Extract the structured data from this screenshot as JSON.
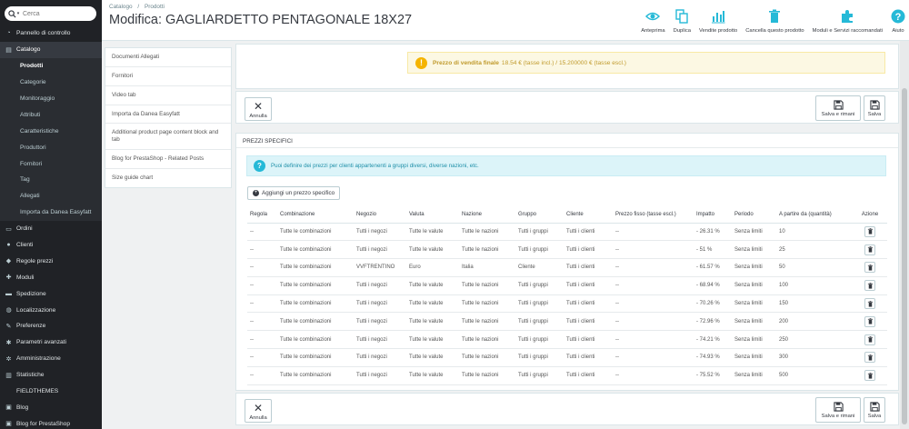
{
  "search": {
    "placeholder": "Cerca"
  },
  "sidebar": {
    "items": [
      {
        "label": "Pannello di controllo",
        "icon": "dashboard-icon"
      },
      {
        "label": "Catalogo",
        "icon": "store-icon",
        "active": true
      },
      {
        "label": "Prodotti",
        "sub": true,
        "current": true
      },
      {
        "label": "Categorie",
        "sub": true
      },
      {
        "label": "Monitoraggio",
        "sub": true
      },
      {
        "label": "Attributi",
        "sub": true
      },
      {
        "label": "Caratteristiche",
        "sub": true
      },
      {
        "label": "Produttori",
        "sub": true
      },
      {
        "label": "Fornitori",
        "sub": true
      },
      {
        "label": "Tag",
        "sub": true
      },
      {
        "label": "Allegati",
        "sub": true
      },
      {
        "label": "Importa da Danea Easyfatt",
        "sub": true
      },
      {
        "label": "Ordini",
        "icon": "credit-card-icon"
      },
      {
        "label": "Clienti",
        "icon": "user-icon"
      },
      {
        "label": "Regole prezzi",
        "icon": "tag-icon"
      },
      {
        "label": "Moduli",
        "icon": "puzzle-icon"
      },
      {
        "label": "Spedizione",
        "icon": "truck-icon"
      },
      {
        "label": "Localizzazione",
        "icon": "globe-icon"
      },
      {
        "label": "Preferenze",
        "icon": "wrench-icon"
      },
      {
        "label": "Parametri avanzati",
        "icon": "cogs-icon"
      },
      {
        "label": "Amministrazione",
        "icon": "gear-icon"
      },
      {
        "label": "Statistiche",
        "icon": "bar-chart-icon"
      },
      {
        "label": "FIELDTHEMES",
        "plain": true
      },
      {
        "label": "Blog",
        "icon": "blog-icon"
      },
      {
        "label": "Blog for PrestaShop",
        "icon": "blog-icon"
      }
    ]
  },
  "header": {
    "breadcrumb": [
      "Catalogo",
      "Prodotti"
    ],
    "breadcrumb_sep": "/",
    "title": "Modifica: GAGLIARDETTO PENTAGONALE 18X27"
  },
  "toolbar": [
    {
      "label": "Anteprima",
      "icon": "eye-icon"
    },
    {
      "label": "Duplica",
      "icon": "copy-icon"
    },
    {
      "label": "Vendite prodotto",
      "icon": "bar-chart-icon"
    },
    {
      "label": "Cancella questo prodotto",
      "icon": "trash-icon"
    },
    {
      "label": "Moduli e Servizi raccomandati",
      "icon": "puzzle-icon"
    },
    {
      "label": "Aiuto",
      "icon": "help-icon"
    }
  ],
  "tabs": [
    "Documenti Allegati",
    "Fornitori",
    "Video tab",
    "Importa da Danea Easyfatt",
    "Additional product page content block and tab",
    "Blog for PrestaShop - Related Posts",
    "Size guide chart"
  ],
  "final_price": {
    "label": "Prezzo di vendita finale",
    "value": "18.54 € (tasse incl.) / 15.200000 € (tasse escl.)"
  },
  "buttons": {
    "cancel": "Annulla",
    "save_stay": "Salva e rimani",
    "save": "Salva"
  },
  "specific_prices": {
    "title": "Prezzi specifici",
    "info": "Puoi definire dei prezzi per clienti appartenenti a gruppi diversi, diverse nazioni, etc.",
    "add_label": "Aggiungi un prezzo specifico",
    "columns": [
      "Regola",
      "Combinazione",
      "Negozio",
      "Valuta",
      "Nazione",
      "Gruppo",
      "Cliente",
      "Prezzo fisso (tasse escl.)",
      "Impatto",
      "Periodo",
      "A partire da (quantità)",
      "Azione"
    ],
    "rows": [
      [
        "--",
        "Tutte le combinazioni",
        "Tutti i negozi",
        "Tutte le valute",
        "Tutte le nazioni",
        "Tutti i gruppi",
        "Tutti i clienti",
        "--",
        "- 26.31 %",
        "Senza limiti",
        "10"
      ],
      [
        "--",
        "Tutte le combinazioni",
        "Tutti i negozi",
        "Tutte le valute",
        "Tutte le nazioni",
        "Tutti i gruppi",
        "Tutti i clienti",
        "--",
        "- 51 %",
        "Senza limiti",
        "25"
      ],
      [
        "--",
        "Tutte le combinazioni",
        "VVFTRENTINO",
        "Euro",
        "Italia",
        "Cliente",
        "Tutti i clienti",
        "--",
        "- 61.57 %",
        "Senza limiti",
        "50"
      ],
      [
        "--",
        "Tutte le combinazioni",
        "Tutti i negozi",
        "Tutte le valute",
        "Tutte le nazioni",
        "Tutti i gruppi",
        "Tutti i clienti",
        "--",
        "- 68.94 %",
        "Senza limiti",
        "100"
      ],
      [
        "--",
        "Tutte le combinazioni",
        "Tutti i negozi",
        "Tutte le valute",
        "Tutte le nazioni",
        "Tutti i gruppi",
        "Tutti i clienti",
        "--",
        "- 70.26 %",
        "Senza limiti",
        "150"
      ],
      [
        "--",
        "Tutte le combinazioni",
        "Tutti i negozi",
        "Tutte le valute",
        "Tutte le nazioni",
        "Tutti i gruppi",
        "Tutti i clienti",
        "--",
        "- 72.96 %",
        "Senza limiti",
        "200"
      ],
      [
        "--",
        "Tutte le combinazioni",
        "Tutti i negozi",
        "Tutte le valute",
        "Tutte le nazioni",
        "Tutti i gruppi",
        "Tutti i clienti",
        "--",
        "- 74.21 %",
        "Senza limiti",
        "250"
      ],
      [
        "--",
        "Tutte le combinazioni",
        "Tutti i negozi",
        "Tutte le valute",
        "Tutte le nazioni",
        "Tutti i gruppi",
        "Tutti i clienti",
        "--",
        "- 74.93 %",
        "Senza limiti",
        "300"
      ],
      [
        "--",
        "Tutte le combinazioni",
        "Tutti i negozi",
        "Tutte le valute",
        "Tutte le nazioni",
        "Tutti i gruppi",
        "Tutti i clienti",
        "--",
        "- 75.52 %",
        "Senza limiti",
        "500"
      ]
    ]
  },
  "colors": {
    "accent": "#25b9d7",
    "sidebar": "#202226",
    "warning": "#f5b400"
  }
}
